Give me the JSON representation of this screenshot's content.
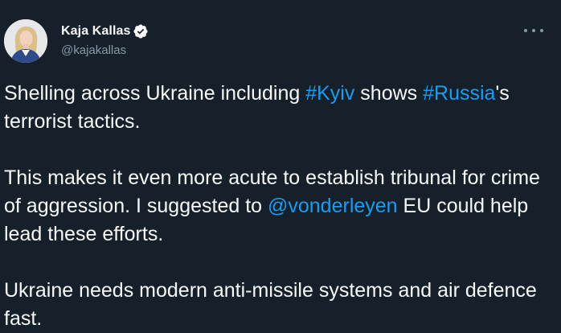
{
  "author": {
    "display_name": "Kaja Kallas",
    "handle": "@kajakallas",
    "verified": true,
    "avatar": "profile-photo"
  },
  "menu": {
    "icon": "more-horizontal-icon"
  },
  "tweet": {
    "p1": {
      "t1": "Shelling across Ukraine including ",
      "l1": "#Kyiv",
      "t2": " shows ",
      "l2": "#Russia",
      "t3": "'s terrorist tactics."
    },
    "p2": {
      "t1": "This makes it even more acute to establish tribunal for crime of aggression. I suggested to ",
      "l1": "@vonderleyen",
      "t2": " EU could help lead these efforts."
    },
    "p3": {
      "t1": "Ukraine needs modern anti-missile systems and air defence fast."
    }
  },
  "colors": {
    "background": "#15202b",
    "text": "#f7f9f9",
    "secondary": "#8b98a5",
    "link": "#1d9bf0"
  }
}
